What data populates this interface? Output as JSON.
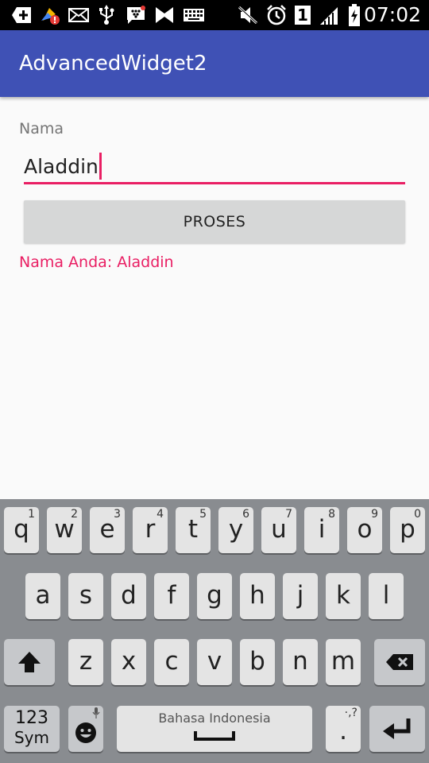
{
  "status_bar": {
    "time": "07:02",
    "icons": [
      "add-icon",
      "cleaner-alert-icon",
      "mail-icon",
      "usb-icon",
      "bbm-icon",
      "media-icon",
      "keyboard-icon",
      "mute-icon",
      "alarm-icon",
      "sim-1-icon",
      "signal-icon",
      "battery-icon"
    ],
    "sim_label": "1"
  },
  "app_bar": {
    "title": "AdvancedWidget2"
  },
  "form": {
    "label": "Nama",
    "input_value": "Aladdin",
    "button_label": "PROSES",
    "result_text": "Nama Anda: Aladdin",
    "accent_color": "#e91e63"
  },
  "keyboard": {
    "row1": [
      {
        "ch": "q",
        "sup": "1"
      },
      {
        "ch": "w",
        "sup": "2"
      },
      {
        "ch": "e",
        "sup": "3"
      },
      {
        "ch": "r",
        "sup": "4"
      },
      {
        "ch": "t",
        "sup": "5"
      },
      {
        "ch": "y",
        "sup": "6"
      },
      {
        "ch": "u",
        "sup": "7"
      },
      {
        "ch": "i",
        "sup": "8"
      },
      {
        "ch": "o",
        "sup": "9"
      },
      {
        "ch": "p",
        "sup": "0"
      }
    ],
    "row2": [
      "a",
      "s",
      "d",
      "f",
      "g",
      "h",
      "j",
      "k",
      "l"
    ],
    "row3": [
      "z",
      "x",
      "c",
      "v",
      "b",
      "n",
      "m"
    ],
    "sym_top": "123",
    "sym_bottom": "Sym",
    "space_label": "Bahasa Indonesia",
    "period": ".",
    "period_sup": "·,?",
    "colors": {
      "background": "#898c90",
      "key": "#e4e4e4",
      "dark_key": "#c6c8cb"
    }
  }
}
